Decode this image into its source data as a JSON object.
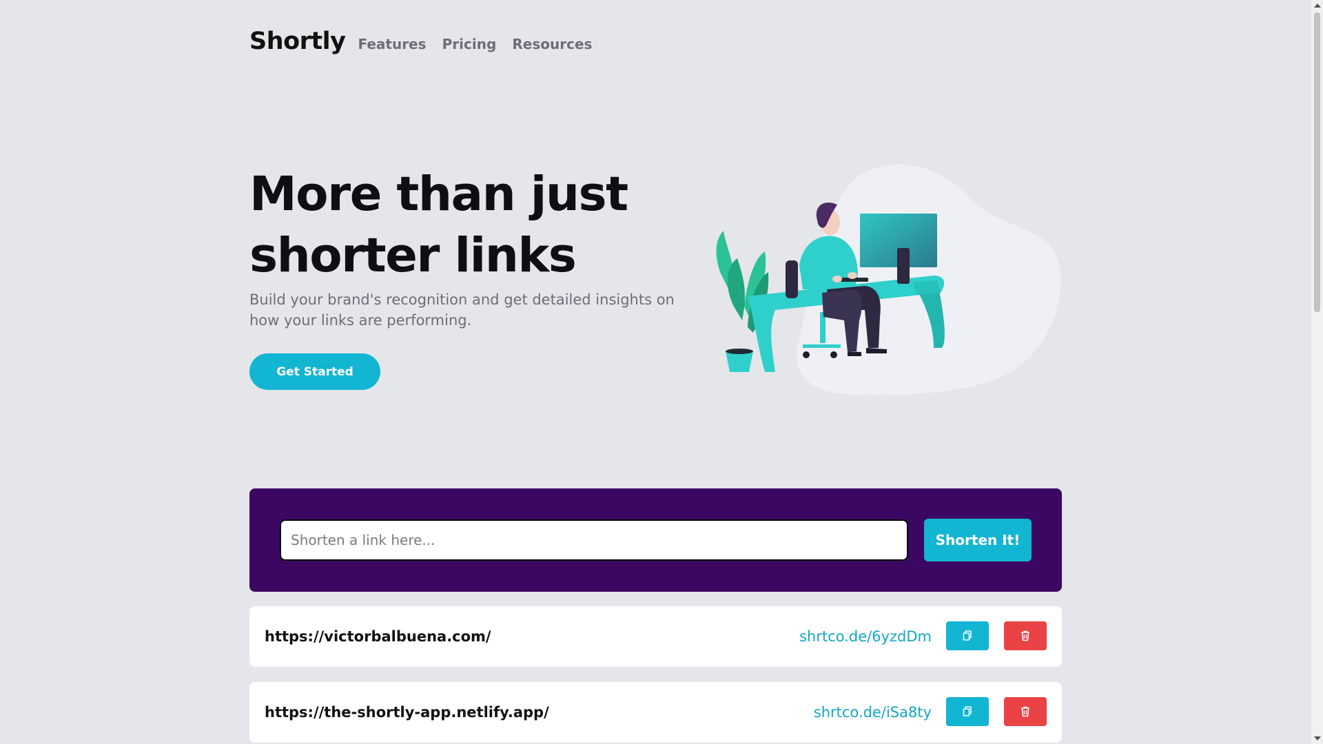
{
  "header": {
    "logo": "Shortly",
    "nav": [
      "Features",
      "Pricing",
      "Resources"
    ]
  },
  "hero": {
    "title_line1": "More than just",
    "title_line2": "shorter links",
    "subtitle": "Build your brand's recognition and get detailed insights on how your links are performing.",
    "cta_label": "Get Started"
  },
  "shorten": {
    "placeholder": "Shorten a link here...",
    "button_label": "Shorten It!"
  },
  "results": [
    {
      "original": "https://victorbalbuena.com/",
      "short": "shrtco.de/6yzdDm"
    },
    {
      "original": "https://the-shortly-app.netlify.app/",
      "short": "shrtco.de/iSa8ty"
    }
  ],
  "icons": {
    "copy": "copy-icon",
    "delete": "trash-icon"
  },
  "colors": {
    "accent": "#12b5d2",
    "dark_violet": "#3b0762",
    "danger": "#ea4245",
    "background": "#e5e6ea"
  }
}
